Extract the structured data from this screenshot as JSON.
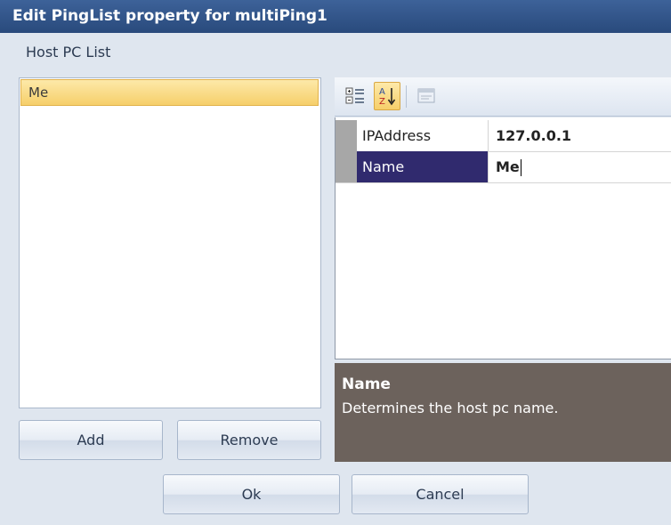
{
  "window": {
    "title": "Edit PingList property for multiPing1"
  },
  "host_list": {
    "label": "Host PC List",
    "items": [
      {
        "label": "Me",
        "selected": true
      }
    ]
  },
  "buttons": {
    "add": "Add",
    "remove": "Remove",
    "ok": "Ok",
    "cancel": "Cancel"
  },
  "property_grid": {
    "toolbar": [
      {
        "icon": "categorized-icon",
        "pressed": false
      },
      {
        "icon": "sort-alphabetical-icon",
        "pressed": true
      },
      {
        "icon": "property-pages-icon",
        "pressed": false,
        "disabled": true
      }
    ],
    "rows": [
      {
        "name": "IPAddress",
        "value": "127.0.0.1"
      },
      {
        "name": "Name",
        "value": "Me",
        "selected": true,
        "editing": true
      }
    ],
    "help": {
      "title": "Name",
      "description": "Determines the host pc name."
    }
  },
  "colors": {
    "title_bar": "#2f548a",
    "selection_highlight": "#f8d57a",
    "selected_property": "#302a6e",
    "help_panel": "#6c625c"
  }
}
